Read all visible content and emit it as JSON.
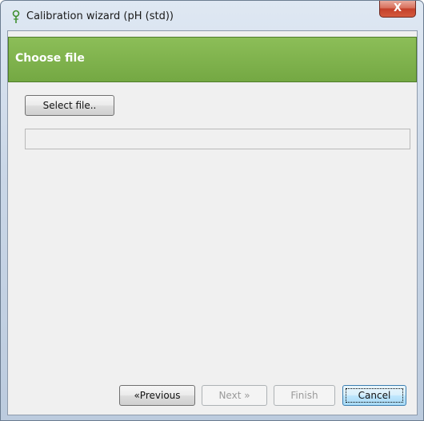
{
  "window": {
    "title": "Calibration wizard (pH (std))",
    "close_label": "X"
  },
  "header": {
    "title": "Choose file"
  },
  "select_file_label": "Select file..",
  "file_path_value": "",
  "buttons": {
    "previous": "«Previous",
    "next": "Next »",
    "finish": "Finish",
    "cancel": "Cancel"
  },
  "colors": {
    "header_green": "#7AAE48",
    "close_red": "#C94A35",
    "default_button_blue": "#3C7FB1"
  },
  "icons": {
    "app_icon": "ph-probe-icon",
    "close_icon": "close-icon"
  }
}
